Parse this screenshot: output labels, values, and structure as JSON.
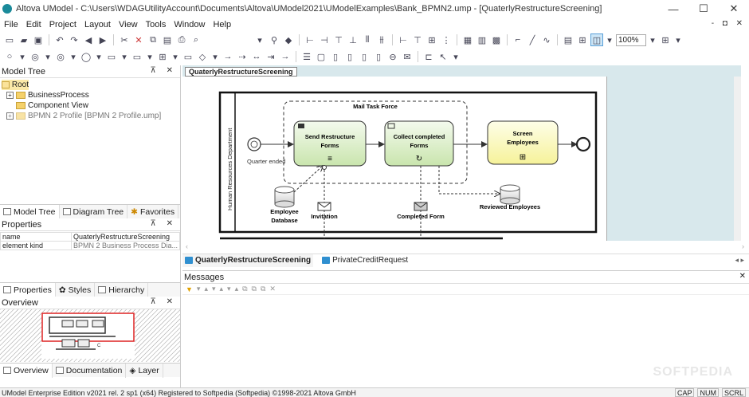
{
  "window": {
    "title": "Altova UModel - C:\\Users\\WDAGUtilityAccount\\Documents\\Altova\\UModel2021\\UModelExamples\\Bank_BPMN2.ump - [QuaterlyRestructureScreening]",
    "minimize": "—",
    "maximize": "☐",
    "close": "✕"
  },
  "menu": {
    "items": [
      "File",
      "Edit",
      "Project",
      "Layout",
      "View",
      "Tools",
      "Window",
      "Help"
    ],
    "mdi_controls": "- ◘ ✕"
  },
  "toolbar": {
    "zoom": "100%"
  },
  "model_tree": {
    "header": "Model Tree",
    "pin": "⊼ ✕",
    "items": [
      {
        "label": "Root",
        "level": 0
      },
      {
        "label": "BusinessProcess",
        "level": 1
      },
      {
        "label": "Component View",
        "level": 1
      },
      {
        "label": "BPMN 2 Profile [BPMN 2 Profile.ump]",
        "level": 1
      }
    ],
    "tabs": [
      "Model Tree",
      "Diagram Tree",
      "Favorites"
    ]
  },
  "properties": {
    "header": "Properties",
    "pin": "⊼ ✕",
    "rows": [
      {
        "key": "name",
        "value": "QuaterlyRestructureScreening"
      },
      {
        "key": "element kind",
        "value": "BPMN 2 Business Process Dia..."
      }
    ],
    "tabs": [
      "Properties",
      "Styles",
      "Hierarchy"
    ]
  },
  "overview": {
    "header": "Overview",
    "pin": "⊼ ✕",
    "tabs": [
      "Overview",
      "Documentation",
      "Layer"
    ]
  },
  "diagram": {
    "tab_label": "QuaterlyRestructureScreening",
    "pool_label": "Human Resources Department",
    "group_label": "Mail Task Force",
    "start_event_label": "Quarter ended",
    "tasks": [
      {
        "label_line1": "Send Restructure",
        "label_line2": "Forms",
        "marker": "≡"
      },
      {
        "label_line1": "Collect completed",
        "label_line2": "Forms",
        "marker": "↻"
      },
      {
        "label_line1": "Screen",
        "label_line2": "Employees",
        "marker": "⊞"
      }
    ],
    "data_stores": [
      {
        "label_line1": "Employee",
        "label_line2": "Database"
      },
      {
        "label_line1": "Reviewed Employees",
        "label_line2": ""
      }
    ],
    "messages": [
      "Invitation",
      "Completed Form"
    ],
    "colors": {
      "task_fill": "#dcefc8",
      "task_fill_yellow": "#fdfbc2",
      "canvas_bg": "#d8e8ec"
    }
  },
  "document_tabs": [
    "QuaterlyRestructureScreening",
    "PrivateCreditRequest"
  ],
  "messages_panel": {
    "header": "Messages",
    "close": "✕"
  },
  "statusbar": {
    "text": "UModel Enterprise Edition v2021 rel. 2 sp1 (x64)   Registered to Softpedia (Softpedia)   ©1998-2021 Altova GmbH",
    "indicators": [
      "CAP",
      "NUM",
      "SCRL"
    ]
  },
  "watermark": "SOFTPEDIA"
}
